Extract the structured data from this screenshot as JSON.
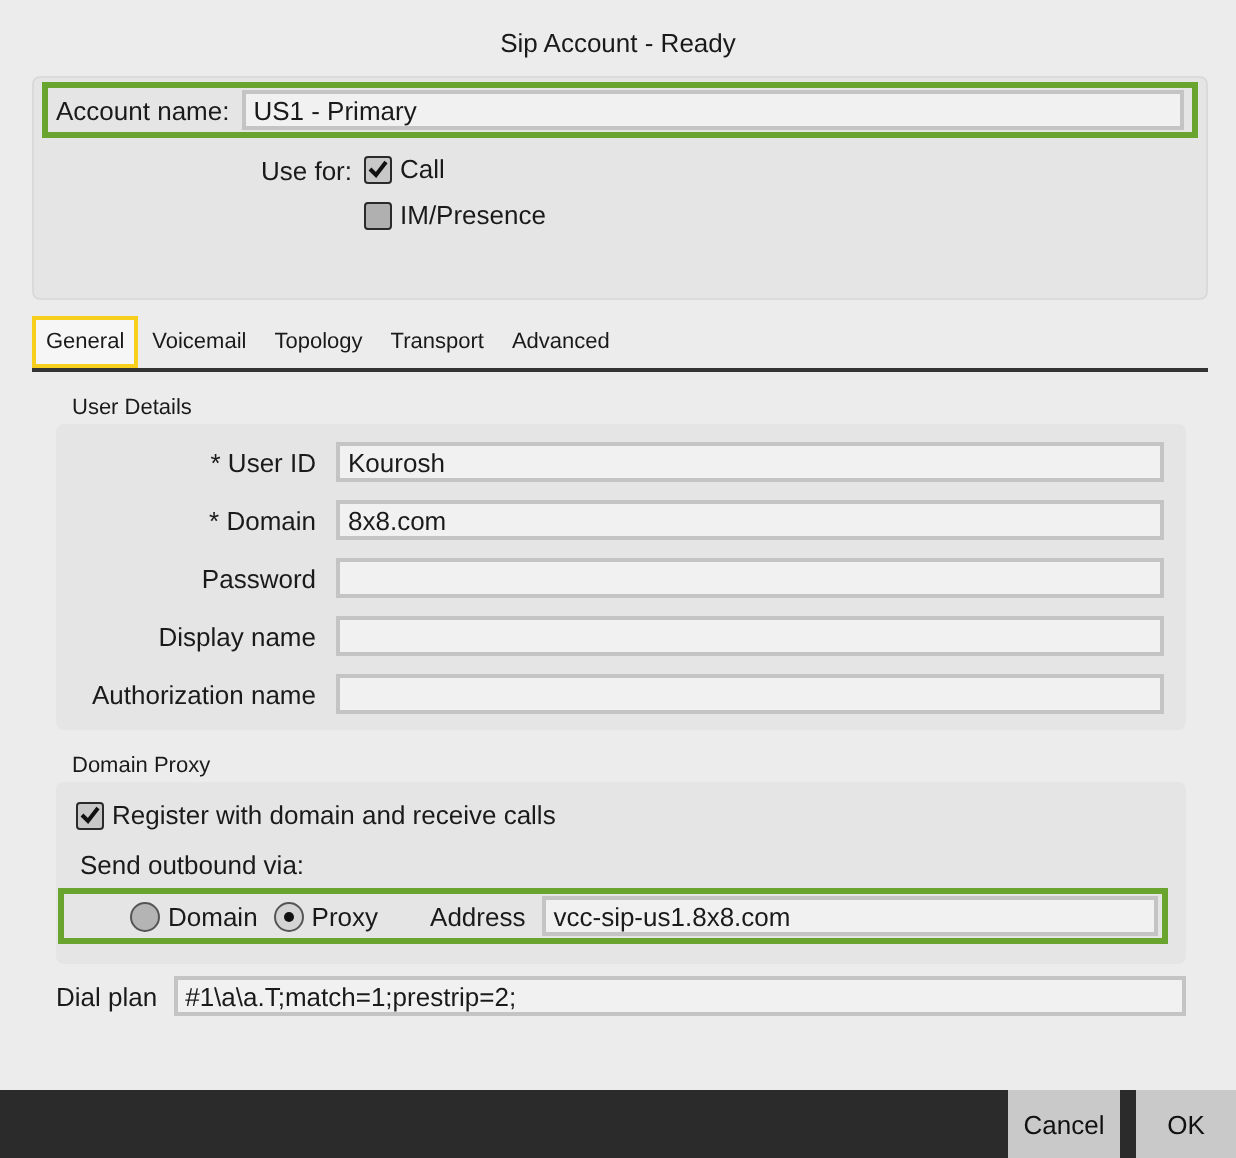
{
  "window": {
    "title": "Sip Account - Ready"
  },
  "account": {
    "label": "Account name:",
    "value": "US1 - Primary",
    "highlighted": true
  },
  "use_for": {
    "label": "Use for:",
    "options": [
      {
        "label": "Call",
        "checked": true
      },
      {
        "label": "IM/Presence",
        "checked": false
      }
    ]
  },
  "tabs": [
    {
      "label": "General",
      "selected": true
    },
    {
      "label": "Voicemail",
      "selected": false
    },
    {
      "label": "Topology",
      "selected": false
    },
    {
      "label": "Transport",
      "selected": false
    },
    {
      "label": "Advanced",
      "selected": false
    }
  ],
  "user_details": {
    "title": "User Details",
    "fields": [
      {
        "label": "* User ID",
        "value": "Kourosh"
      },
      {
        "label": "* Domain",
        "value": "8x8.com"
      },
      {
        "label": "Password"
      },
      {
        "label": "Display name"
      },
      {
        "label": "Authorization name"
      }
    ]
  },
  "domain_proxy": {
    "title": "Domain Proxy",
    "register": {
      "label": "Register with domain and receive calls",
      "checked": true
    },
    "outbound": {
      "label": "Send outbound via:",
      "highlighted": true,
      "options": [
        {
          "label": "Domain",
          "selected": false
        },
        {
          "label": "Proxy",
          "selected": true
        }
      ],
      "address_label": "Address",
      "address": "vcc-sip-us1.8x8.com"
    }
  },
  "dial_plan": {
    "label": "Dial plan",
    "value": "#1\\a\\a.T;match=1;prestrip=2;"
  },
  "buttons": [
    "Cancel",
    "OK"
  ]
}
